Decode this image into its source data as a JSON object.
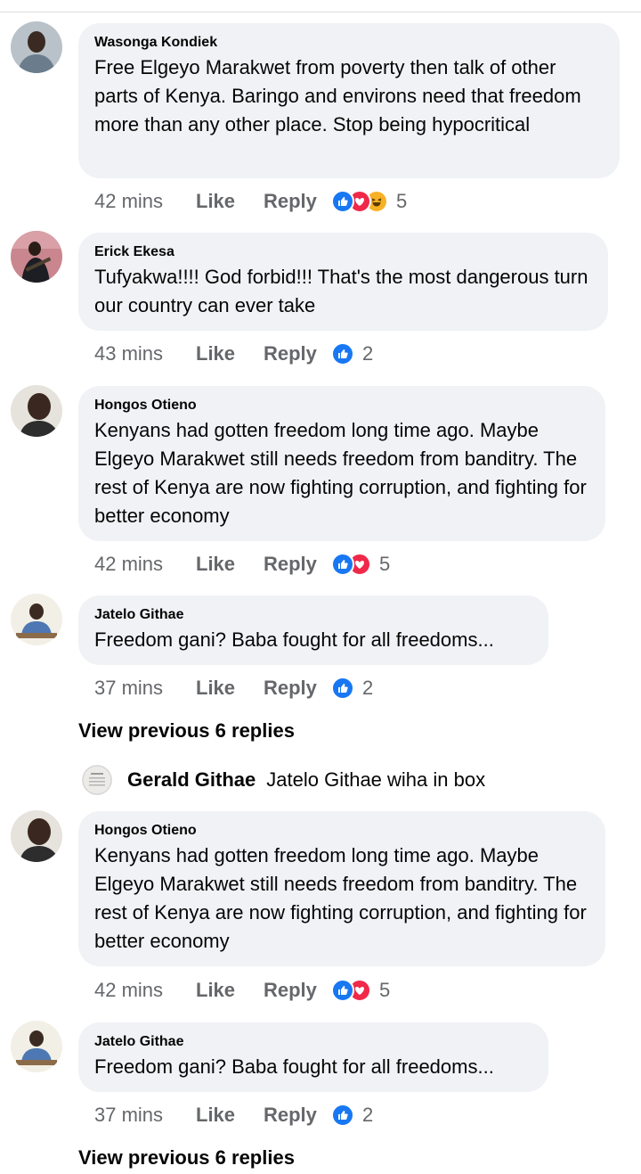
{
  "comments": [
    {
      "author": "Wasonga Kondiek",
      "text": "Free Elgeyo Marakwet from poverty then talk of other parts of Kenya. Baringo and environs need that freedom more than any other place. Stop being hypocritical",
      "time": "42 mins",
      "like": "Like",
      "reply": "Reply",
      "reactions": [
        "like",
        "love",
        "haha"
      ],
      "count": "5",
      "avatar_icon": "man-portrait-icon"
    },
    {
      "author": "Erick Ekesa",
      "text": "Tufyakwa!!!! God forbid!!! That's the most dangerous turn our country can ever take",
      "time": "43 mins",
      "like": "Like",
      "reply": "Reply",
      "reactions": [
        "like"
      ],
      "count": "2",
      "avatar_icon": "guitarist-portrait-icon"
    },
    {
      "author": "Hongos Otieno",
      "text": "Kenyans had gotten freedom long time ago. Maybe Elgeyo Marakwet still needs freedom from banditry. The rest of Kenya are now fighting corruption, and fighting for better economy",
      "time": "42 mins",
      "like": "Like",
      "reply": "Reply",
      "reactions": [
        "like",
        "love"
      ],
      "count": "5",
      "avatar_icon": "man-portrait-icon"
    },
    {
      "author": "Jatelo Githae",
      "text": "Freedom gani? Baba fought for all freedoms...",
      "time": "37 mins",
      "like": "Like",
      "reply": "Reply",
      "reactions": [
        "like"
      ],
      "count": "2",
      "avatar_icon": "man-at-desk-icon"
    },
    {
      "author": "Hongos Otieno",
      "text": "Kenyans had gotten freedom long time ago. Maybe Elgeyo Marakwet still needs freedom from banditry. The rest of Kenya are now fighting corruption, and fighting for better economy",
      "time": "42 mins",
      "like": "Like",
      "reply": "Reply",
      "reactions": [
        "like",
        "love"
      ],
      "count": "5",
      "avatar_icon": "man-portrait-icon"
    },
    {
      "author": "Jatelo Githae",
      "text": "Freedom gani? Baba fought for all freedoms...",
      "time": "37 mins",
      "like": "Like",
      "reply": "Reply",
      "reactions": [
        "like"
      ],
      "count": "2",
      "avatar_icon": "man-at-desk-icon"
    }
  ],
  "view_previous": [
    "View previous 6 replies",
    "View previous 6 replies"
  ],
  "nested_reply": {
    "author": "Gerald Githae",
    "text": "Jatelo Githae wiha in box",
    "avatar_icon": "document-avatar-icon"
  },
  "colors": {
    "bubble": "#f0f2f5",
    "meta": "#65676b",
    "like": "#1877f2",
    "love": "#f02849",
    "haha": "#f7b125"
  }
}
